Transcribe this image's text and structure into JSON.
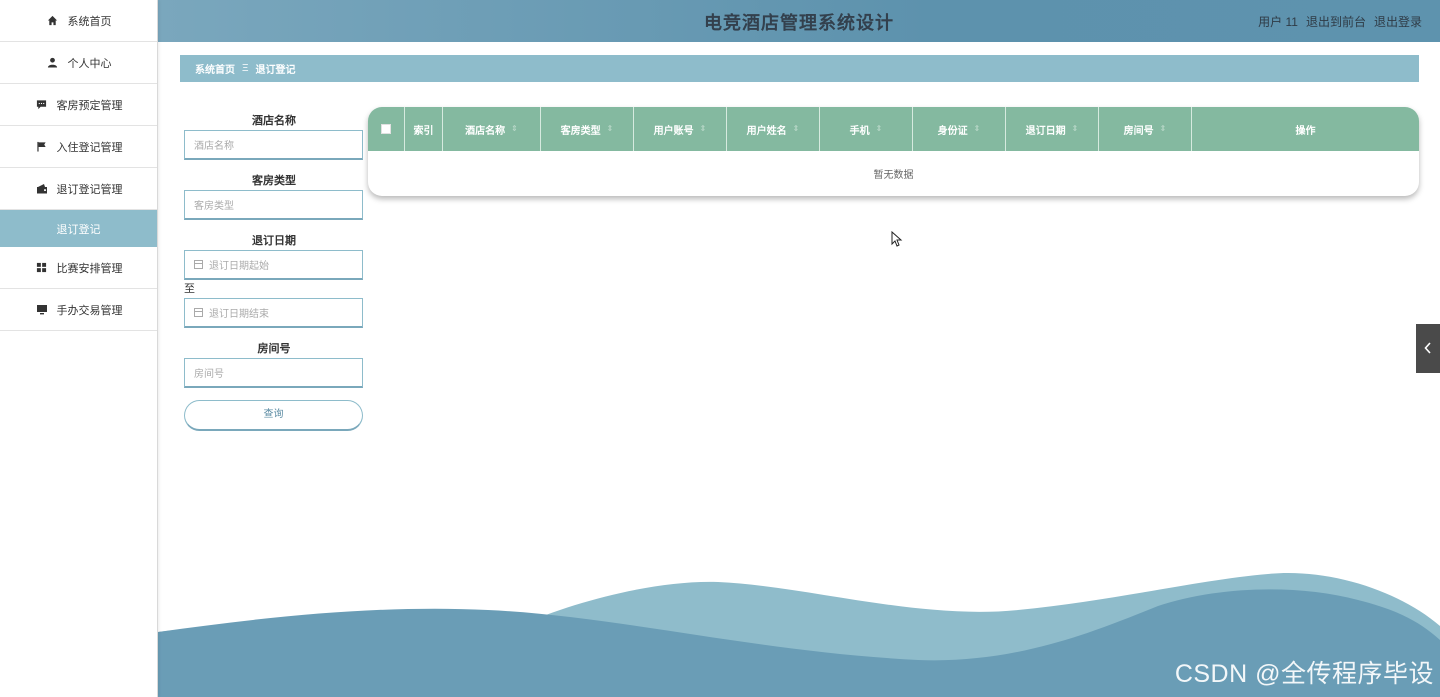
{
  "header": {
    "title": "电竞酒店管理系统设计",
    "user_label": "用户 11",
    "to_front": "退出到前台",
    "logout": "退出登录"
  },
  "sidebar": {
    "items": [
      {
        "label": "系统首页",
        "icon": "home-icon"
      },
      {
        "label": "个人中心",
        "icon": "user-icon"
      },
      {
        "label": "客房预定管理",
        "icon": "comment-icon"
      },
      {
        "label": "入住登记管理",
        "icon": "flag-icon"
      },
      {
        "label": "退订登记管理",
        "icon": "wallet-icon"
      },
      {
        "label": "退订登记",
        "icon": ""
      },
      {
        "label": "比赛安排管理",
        "icon": "grid-icon"
      },
      {
        "label": "手办交易管理",
        "icon": "monitor-icon"
      }
    ]
  },
  "breadcrumb": {
    "home": "系统首页",
    "separator": "Ξ",
    "current": "退订登记"
  },
  "search": {
    "hotel_label": "酒店名称",
    "hotel_placeholder": "酒店名称",
    "room_type_label": "客房类型",
    "room_type_placeholder": "客房类型",
    "date_label": "退订日期",
    "date_start_placeholder": "退订日期起始",
    "to": "至",
    "date_end_placeholder": "退订日期结束",
    "room_no_label": "房间号",
    "room_no_placeholder": "房间号",
    "submit": "查询"
  },
  "table": {
    "columns": [
      "索引",
      "酒店名称",
      "客房类型",
      "用户账号",
      "用户姓名",
      "手机",
      "身份证",
      "退订日期",
      "房间号",
      "操作"
    ],
    "empty_text": "暂无数据"
  },
  "watermark": "CSDN @全传程序毕设",
  "colors": {
    "header": "#5e93ae",
    "accent": "#8ebccb",
    "table_header": "#84b9a0"
  }
}
